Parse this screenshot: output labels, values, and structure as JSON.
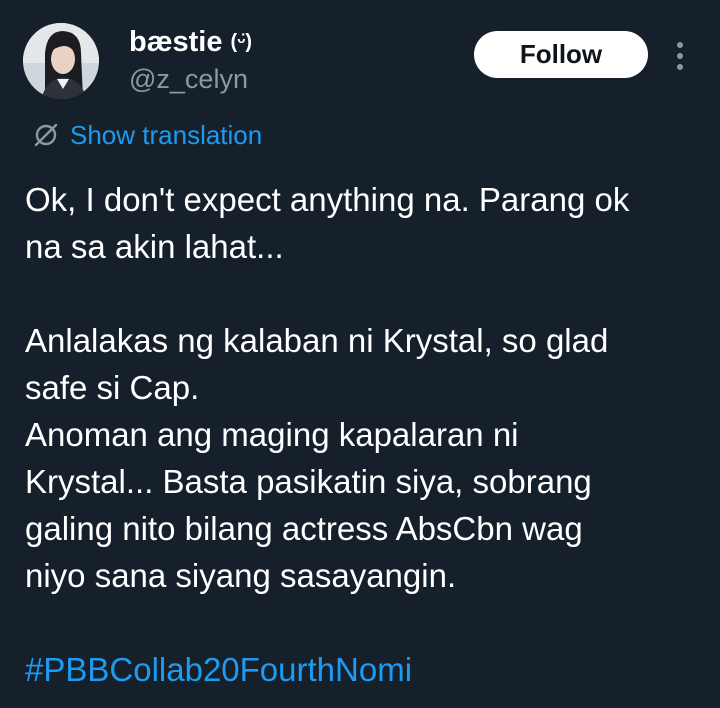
{
  "author": {
    "display_name": "bæstie",
    "badge_glyph": "(ᵕ̈)",
    "handle": "@z_celyn"
  },
  "actions": {
    "follow_label": "Follow"
  },
  "icons": {
    "translate": "translate-slash-icon",
    "more": "more-vertical-icon",
    "avatar": "avatar-photo"
  },
  "translation": {
    "label": "Show translation"
  },
  "tweet": {
    "lines": [
      "Ok, I don't expect anything na. Parang ok",
      "na sa akin lahat...",
      "",
      "Anlalakas ng kalaban ni Krystal, so glad",
      "safe si Cap.",
      "Anoman ang maging kapalaran ni",
      "Krystal... Basta pasikatin siya, sobrang",
      "galing nito bilang actress AbsCbn wag",
      "niyo sana siyang sasayangin."
    ],
    "hashtag": "#PBBCollab20FourthNomi"
  },
  "colors": {
    "background": "#15202b",
    "text": "#ffffff",
    "secondary": "#8b98a5",
    "link": "#1d9bf0"
  }
}
